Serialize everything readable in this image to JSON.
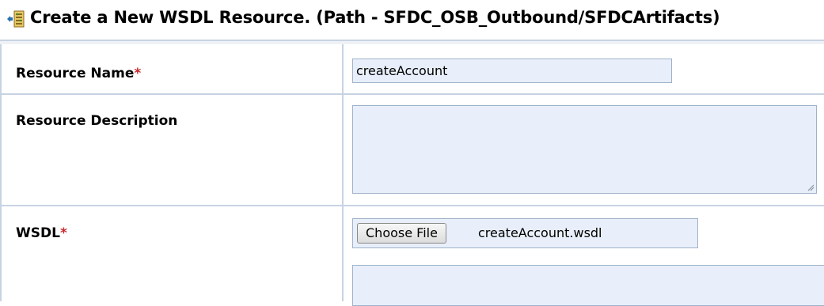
{
  "header": {
    "icon": "wsdl-resource-icon",
    "title": "Create a New WSDL Resource. (Path - SFDC_OSB_Outbound/SFDCArtifacts)"
  },
  "form": {
    "required_marker": "*",
    "resource_name": {
      "label": "Resource Name",
      "value": "createAccount"
    },
    "resource_description": {
      "label": "Resource Description",
      "value": ""
    },
    "wsdl": {
      "label": "WSDL",
      "choose_button_label": "Choose File",
      "file_name": "createAccount.wsdl",
      "content": ""
    }
  },
  "colors": {
    "field_background": "#e8effa",
    "field_border": "#9fb2c9",
    "grid_line": "#c7d3e2",
    "required_marker": "#c6282b"
  }
}
